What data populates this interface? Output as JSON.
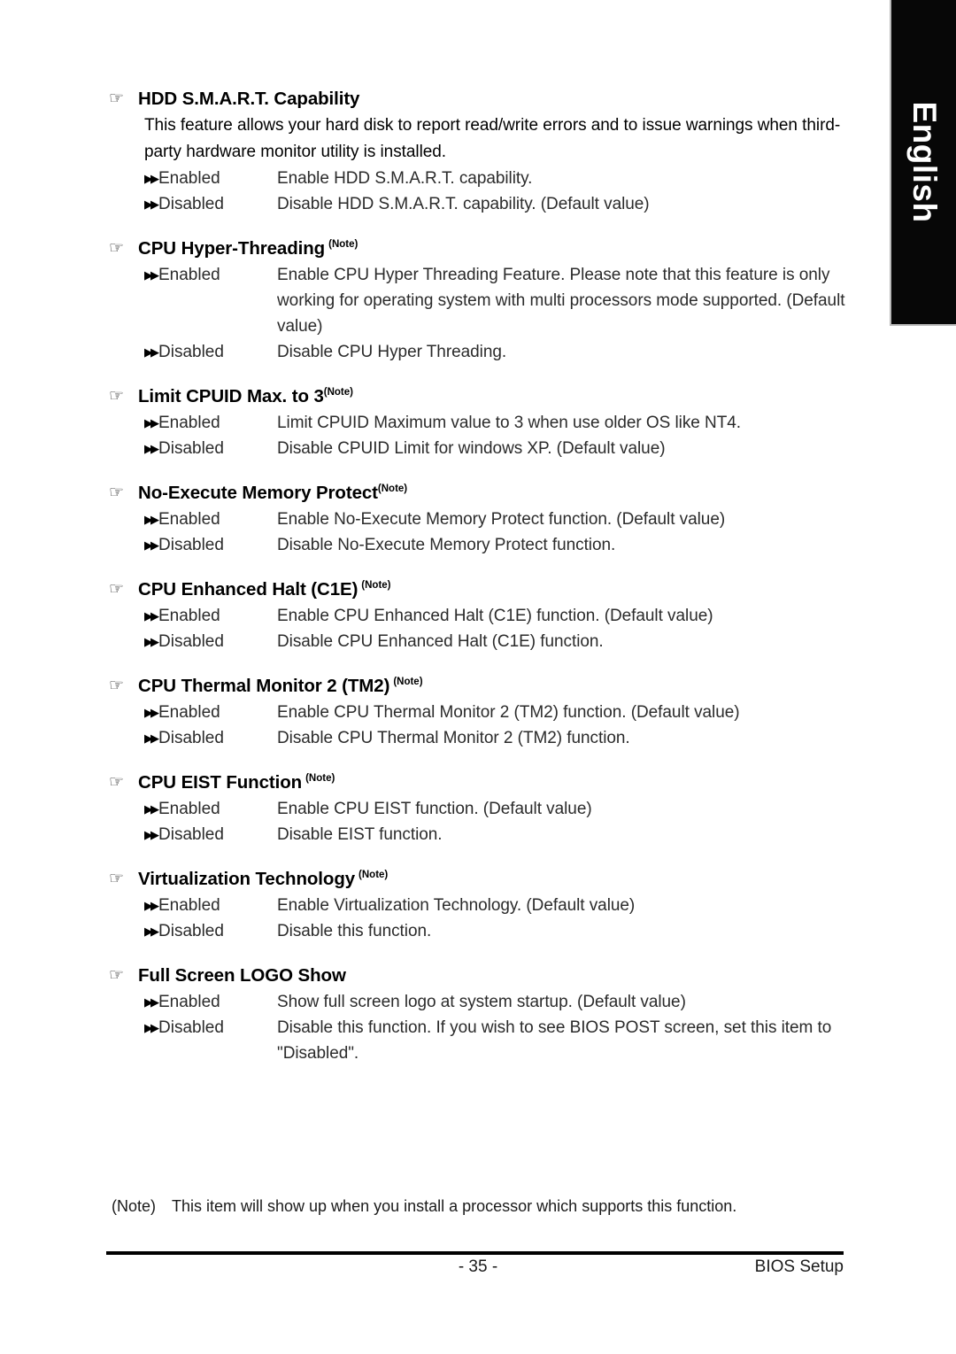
{
  "page": {
    "language_tab": "English",
    "page_number": "- 35 -",
    "footer_right": "BIOS Setup",
    "footnote_tag": "(Note)",
    "footnote_text": "This item will show up when you install a processor which supports this function.",
    "hand_icon": "☞",
    "option_bullet": "▶▶",
    "note_marker": "(Note)"
  },
  "sections": [
    {
      "title": "HDD S.M.A.R.T. Capability",
      "note": false,
      "intro": "This feature allows your hard disk to report read/write errors and to issue warnings when third-party hardware monitor utility is installed.",
      "options": [
        {
          "label": "Enabled",
          "desc": "Enable HDD S.M.A.R.T. capability."
        },
        {
          "label": "Disabled",
          "desc": "Disable HDD S.M.A.R.T. capability. (Default value)"
        }
      ]
    },
    {
      "title": "CPU Hyper-Threading",
      "note": true,
      "note_spaced": true,
      "intro": "",
      "options": [
        {
          "label": "Enabled",
          "desc": "Enable CPU Hyper Threading Feature. Please note that this feature is only working for operating system with multi processors mode supported. (Default value)"
        },
        {
          "label": "Disabled",
          "desc": "Disable CPU Hyper Threading."
        }
      ]
    },
    {
      "title": "Limit CPUID Max. to 3",
      "note": true,
      "note_spaced": false,
      "intro": "",
      "options": [
        {
          "label": "Enabled",
          "desc": "Limit CPUID Maximum value to 3 when use older OS like NT4."
        },
        {
          "label": "Disabled",
          "desc": "Disable CPUID Limit for windows XP. (Default value)"
        }
      ]
    },
    {
      "title": "No-Execute Memory Protect",
      "note": true,
      "note_spaced": false,
      "intro": "",
      "options": [
        {
          "label": "Enabled",
          "desc": "Enable No-Execute Memory Protect function. (Default value)"
        },
        {
          "label": "Disabled",
          "desc": "Disable No-Execute Memory Protect function."
        }
      ]
    },
    {
      "title": "CPU Enhanced Halt (C1E)",
      "note": true,
      "note_spaced": true,
      "intro": "",
      "options": [
        {
          "label": "Enabled",
          "desc": "Enable CPU Enhanced Halt (C1E) function. (Default value)"
        },
        {
          "label": "Disabled",
          "desc": "Disable CPU Enhanced Halt (C1E) function."
        }
      ]
    },
    {
      "title": "CPU Thermal Monitor 2 (TM2)",
      "note": true,
      "note_spaced": true,
      "intro": "",
      "options": [
        {
          "label": "Enabled",
          "desc": "Enable CPU Thermal Monitor 2 (TM2) function. (Default value)"
        },
        {
          "label": "Disabled",
          "desc": "Disable CPU Thermal Monitor 2 (TM2) function."
        }
      ]
    },
    {
      "title": "CPU EIST Function",
      "note": true,
      "note_spaced": true,
      "intro": "",
      "options": [
        {
          "label": "Enabled",
          "desc": "Enable CPU EIST function. (Default value)"
        },
        {
          "label": "Disabled",
          "desc": "Disable EIST function."
        }
      ]
    },
    {
      "title": "Virtualization Technology",
      "note": true,
      "note_spaced": true,
      "intro": "",
      "options": [
        {
          "label": "Enabled",
          "desc": "Enable Virtualization Technology. (Default value)"
        },
        {
          "label": "Disabled",
          "desc": "Disable this function."
        }
      ]
    },
    {
      "title": "Full Screen LOGO Show",
      "note": false,
      "intro": "",
      "options": [
        {
          "label": "Enabled",
          "desc": "Show full screen logo at system startup. (Default value)"
        },
        {
          "label": "Disabled",
          "desc": "Disable this function. If you wish to see BIOS POST screen, set this item to \"Disabled\"."
        }
      ]
    }
  ]
}
